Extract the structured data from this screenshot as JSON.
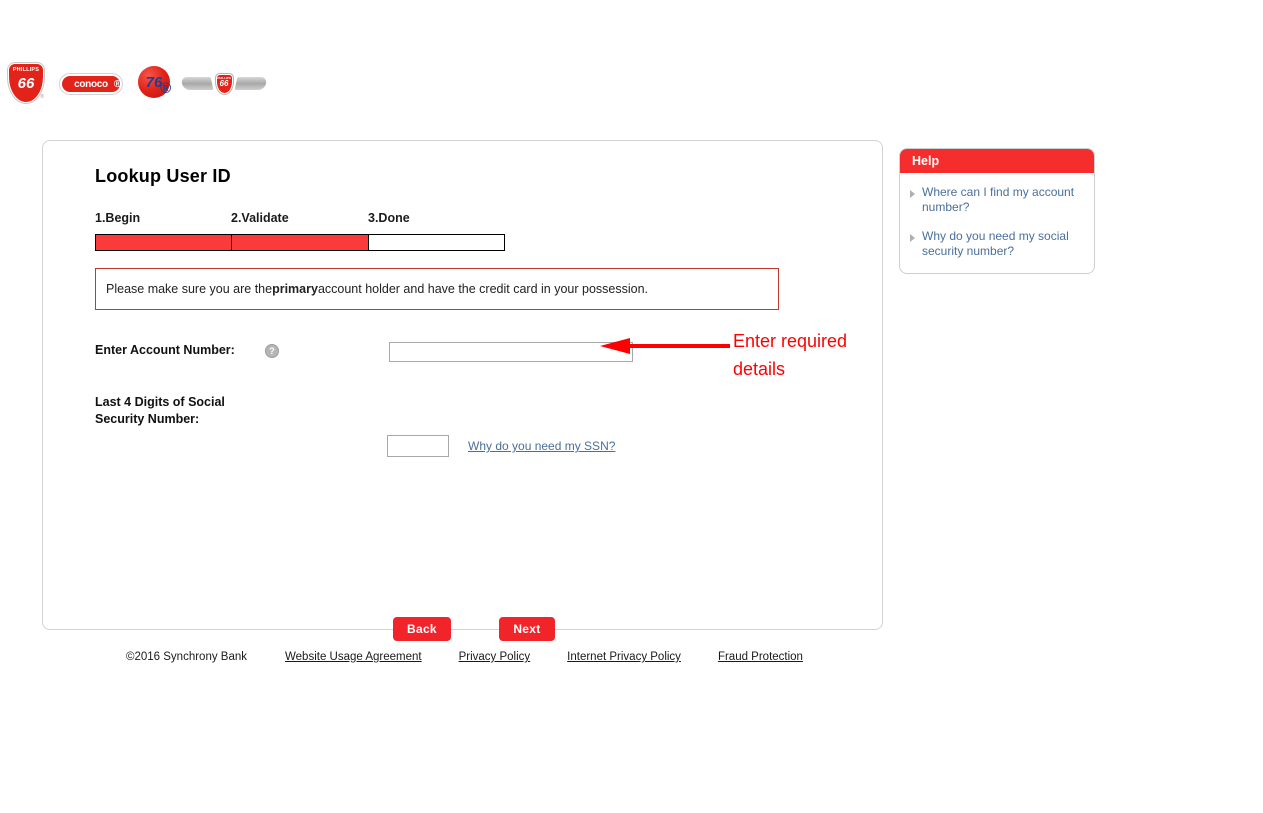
{
  "brands": [
    {
      "name": "Phillips 66",
      "top_text": "PHILLIPS",
      "number": "66"
    },
    {
      "name": "Conoco",
      "wordmark": "conoco"
    },
    {
      "name": "76",
      "number": "76"
    },
    {
      "name": "Phillips 66 Wings",
      "top_text": "PHILLIPS",
      "number": "66"
    }
  ],
  "card": {
    "title": "Lookup User ID",
    "steps": [
      {
        "label": "1.Begin",
        "filled": true
      },
      {
        "label": "2.Validate",
        "filled": true
      },
      {
        "label": "3.Done",
        "filled": false
      }
    ],
    "notice": {
      "before": "Please make sure you are the ",
      "strong": "primary",
      "after": " account holder and have the credit card in your possession."
    },
    "fields": {
      "account": {
        "label": "Enter Account Number:",
        "help_icon": "question-mark-icon",
        "value": "",
        "placeholder": ""
      },
      "ssn": {
        "label_line1": "Last 4 Digits of Social",
        "label_line2": "Security Number:",
        "value": "",
        "placeholder": "",
        "link": "Why do you need my SSN?"
      }
    },
    "buttons": {
      "back": "Back",
      "next": "Next"
    }
  },
  "help": {
    "title": "Help",
    "items": [
      "Where can I find my account number?",
      "Why do you need my social security number?"
    ]
  },
  "annotation": {
    "text": "Enter required details",
    "color": "#ff0000",
    "icon": "left-arrow-icon"
  },
  "footer": {
    "copyright": "©2016 Synchrony Bank",
    "links": [
      "Website Usage Agreement",
      "Privacy Policy",
      "Internet Privacy Policy",
      "Fraud Protection"
    ]
  },
  "colors": {
    "brand_red": "#e2231a",
    "button_red": "#f1242a",
    "help_header_red": "#f52d2d",
    "progress_red": "#fb3b3b",
    "link_blue": "#4a6f9c",
    "annotation_red": "#ff0000"
  }
}
